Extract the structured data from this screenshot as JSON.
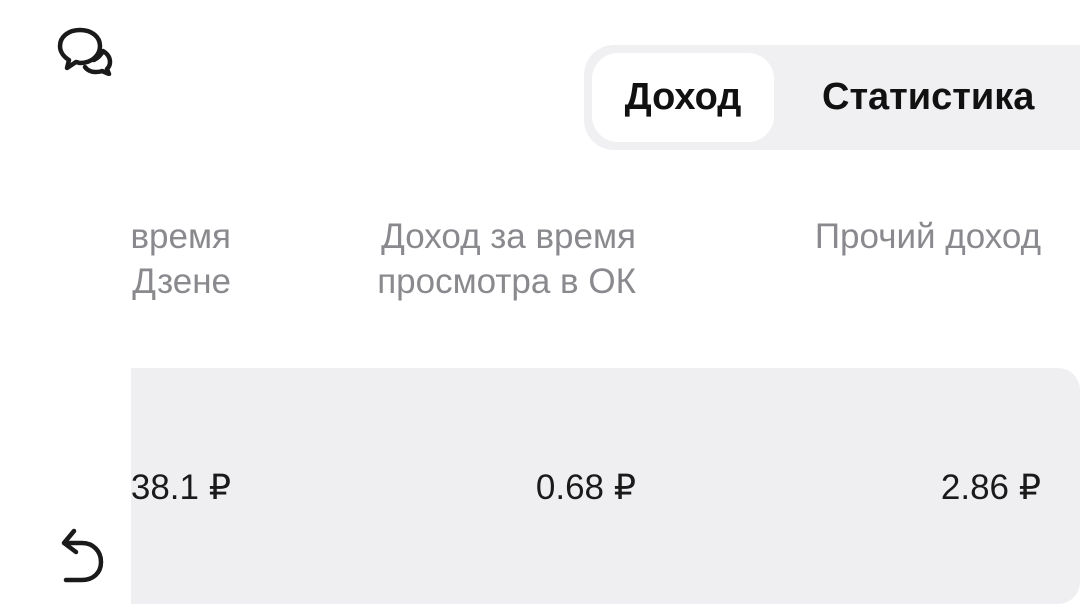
{
  "tabs": {
    "income": "Доход",
    "statistics": "Статистика",
    "active": "income"
  },
  "icons": {
    "chat": "chat-bubbles-icon",
    "undo": "undo-arrow-icon"
  },
  "table": {
    "headers": [
      {
        "line1": "время",
        "line2": "Дзене"
      },
      {
        "line1": "Доход за время",
        "line2": "просмотра в ОК"
      },
      {
        "line1": "Прочий доход",
        "line2": ""
      }
    ],
    "values": [
      "38.1 ₽",
      "0.68 ₽",
      "2.86 ₽"
    ]
  }
}
